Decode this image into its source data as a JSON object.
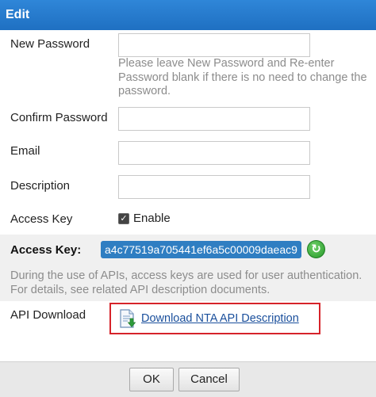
{
  "dialog": {
    "title": "Edit"
  },
  "form": {
    "new_password": {
      "label": "New Password",
      "value": ""
    },
    "password_hint": "Please leave New Password and Re-enter Password blank if there is no need to change the password.",
    "confirm_password": {
      "label": "Confirm Password",
      "value": ""
    },
    "email": {
      "label": "Email",
      "value": ""
    },
    "description": {
      "label": "Description",
      "value": ""
    },
    "access_key": {
      "label": "Access Key",
      "checkbox_label": "Enable",
      "checked": true
    }
  },
  "access_key_panel": {
    "label": "Access Key:",
    "value": "a4c77519a705441ef6a5c00009daeac9",
    "description": "During the use of APIs, access keys are used for user authentication. For details, see related API description documents."
  },
  "api_download": {
    "label": "API Download",
    "link_text": "Download NTA API Description"
  },
  "footer": {
    "ok_label": "OK",
    "cancel_label": "Cancel"
  },
  "icons": {
    "checkbox": "checkmark-icon",
    "refresh": "refresh-icon",
    "download": "document-download-icon"
  },
  "colors": {
    "titlebar": "#2278c9",
    "access_key_badge": "#2f7ec2",
    "highlight_border": "#d6232a",
    "link": "#1a4f9c"
  }
}
